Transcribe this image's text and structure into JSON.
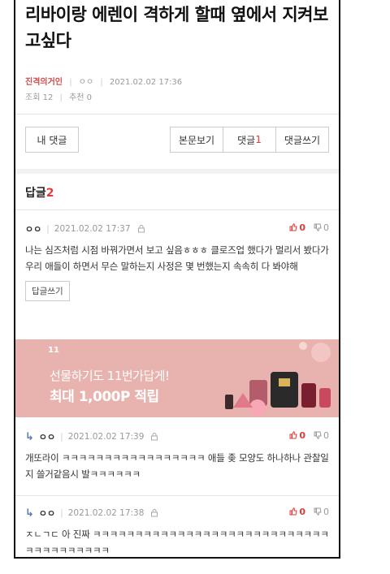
{
  "post": {
    "title": "리바이랑 에렌이 격하게 할때 옆에서 지켜보고싶다",
    "author": "진격의거인",
    "nickname": "ㅇㅇ",
    "datetime": "2021.02.02 17:36",
    "views": "조회 12",
    "recommends": "추천 0"
  },
  "toolbar": {
    "my_comments": "내 댓글",
    "view_body": "본문보기",
    "comments_label": "댓글",
    "comments_count": "1",
    "write_comment": "댓글쓰기"
  },
  "replies": {
    "label": "답글",
    "count": "2"
  },
  "comments": [
    {
      "nick": "ㅇㅇ",
      "datetime": "2021.02.02 17:37",
      "up": "0",
      "down": "0",
      "body": "나는 심즈처럼 시점 바꿔가면서 보고 싶음ㅎㅎㅎ 클로즈업 했다가 멀리서 봤다가 우리 애들이 하면서 무슨 말하는지 사정은 몇 번했는지 속속히 다 봐야해",
      "reply_button": "답글쓰기"
    },
    {
      "nick": "ㅇㅇ",
      "datetime": "2021.02.02 17:39",
      "up": "0",
      "down": "0",
      "body": "개또라이 ㅋㅋㅋㅋㅋㅋㅋㅋㅋㅋㅋㅋㅋㅋㅋㅋㅋ 애들 좆 모양도 하나하나 관찰일지 쓸거같음시 발ㅋㅋㅋㅋㅋㅋ"
    },
    {
      "nick": "ㅇㅇ",
      "datetime": "2021.02.02 17:38",
      "up": "0",
      "down": "0",
      "body": "ㅈㄴㄱㄷ 아 진짜 ㅋㅋㅋㅋㅋㅋㅋㅋㅋㅋㅋㅋㅋㅋㅋㅋㅋㅋㅋㅋㅋㅋㅋㅋㅋㅋㅋㅋㅋㅋㅋㅋㅋㅋㅋㅋㅋㅋ"
    }
  ],
  "banner": {
    "logo": "11",
    "line1": "선물하기도 11번가답게!",
    "line2": "최대 1,000P 적립"
  },
  "colors": {
    "accent_red": "#e03a3a",
    "banner_bg": "#e8b2ae",
    "reply_arrow": "#5b7bb5"
  }
}
